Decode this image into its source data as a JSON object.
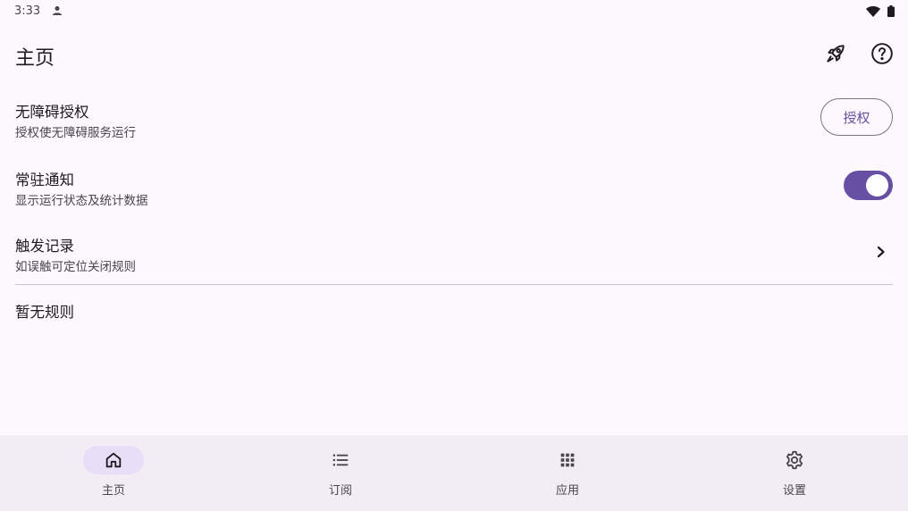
{
  "status_bar": {
    "time": "3:33"
  },
  "header": {
    "title": "主页"
  },
  "settings": {
    "accessibility": {
      "title": "无障碍授权",
      "subtitle": "授权使无障碍服务运行",
      "button_label": "授权"
    },
    "notification": {
      "title": "常驻通知",
      "subtitle": "显示运行状态及统计数据",
      "toggle_on": true
    },
    "trigger_log": {
      "title": "触发记录",
      "subtitle": "如误触可定位关闭规则"
    }
  },
  "empty_state": "暂无规则",
  "bottom_nav": {
    "items": [
      {
        "label": "主页",
        "icon": "home-icon",
        "active": true
      },
      {
        "label": "订阅",
        "icon": "list-icon",
        "active": false
      },
      {
        "label": "应用",
        "icon": "apps-grid-icon",
        "active": false
      },
      {
        "label": "设置",
        "icon": "gear-icon",
        "active": false
      }
    ]
  },
  "colors": {
    "accent": "#6750a4",
    "background": "#fdf7fe",
    "nav_background": "#f2ecf5",
    "nav_active": "#e8def8"
  }
}
